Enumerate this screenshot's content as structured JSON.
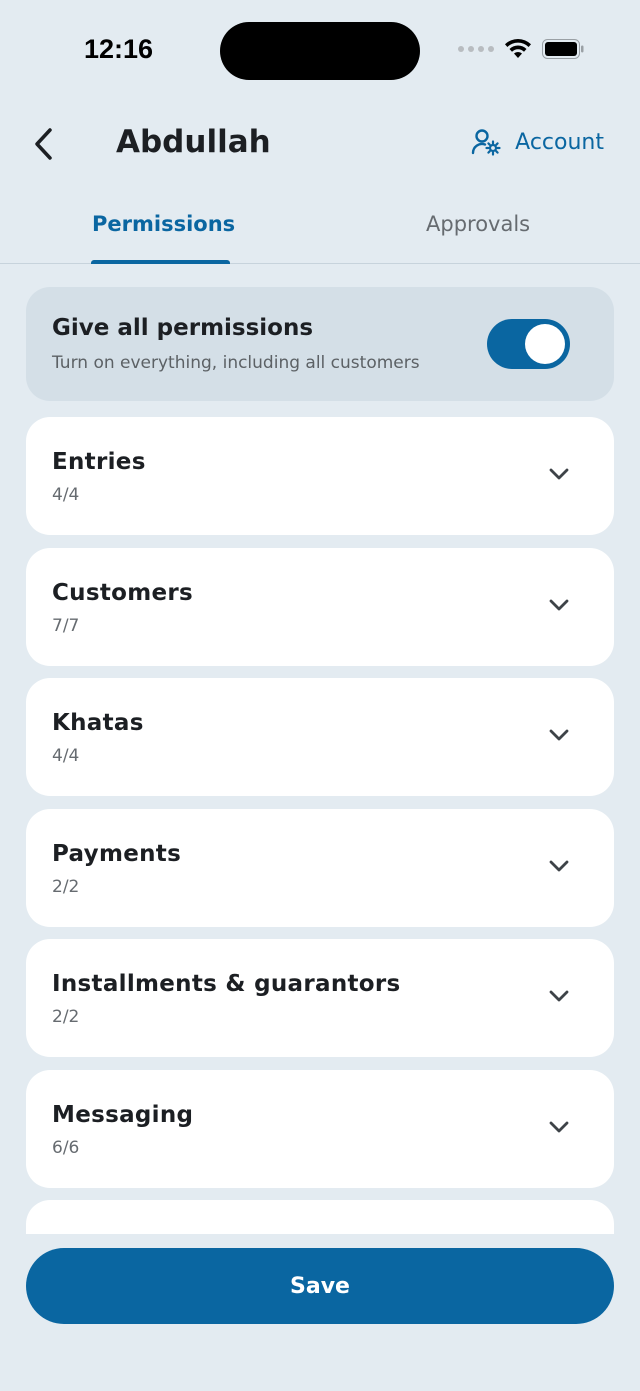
{
  "status_bar": {
    "time": "12:16"
  },
  "header": {
    "title": "Abdullah",
    "account_label": "Account"
  },
  "tabs": [
    {
      "label": "Permissions",
      "active": true
    },
    {
      "label": "Approvals",
      "active": false
    }
  ],
  "give_all": {
    "title": "Give all permissions",
    "subtitle": "Turn on everything, including all customers",
    "enabled": true
  },
  "permissions": [
    {
      "title": "Entries",
      "count": "4/4"
    },
    {
      "title": "Customers",
      "count": "7/7"
    },
    {
      "title": "Khatas",
      "count": "4/4"
    },
    {
      "title": "Payments",
      "count": "2/2"
    },
    {
      "title": "Installments & guarantors",
      "count": "2/2"
    },
    {
      "title": "Messaging",
      "count": "6/6"
    }
  ],
  "save_label": "Save",
  "colors": {
    "accent": "#0a66a1",
    "background": "#e3ebf1"
  }
}
